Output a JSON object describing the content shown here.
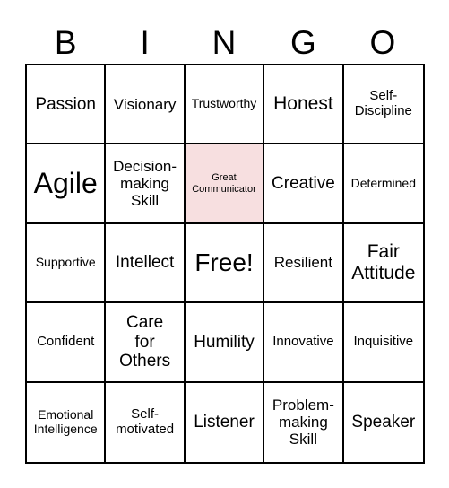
{
  "header": {
    "letters": [
      "B",
      "I",
      "N",
      "G",
      "O"
    ]
  },
  "colors": {
    "highlight": "#f7dfe0",
    "grid_line": "#000000"
  },
  "grid": {
    "rows": [
      [
        "Passion",
        "Visionary",
        "Trustworthy",
        "Honest",
        "Self-\nDiscipline"
      ],
      [
        "Agile",
        "Decision-\nmaking\nSkill",
        "Great\nCommunicator",
        "Creative",
        "Determined"
      ],
      [
        "Supportive",
        "Intellect",
        "Free!",
        "Resilient",
        "Fair\nAttitude"
      ],
      [
        "Confident",
        "Care\nfor\nOthers",
        "Humility",
        "Innovative",
        "Inquisitive"
      ],
      [
        "Emotional\nIntelligence",
        "Self-\nmotivated",
        "Listener",
        "Problem-\nmaking\nSkill",
        "Speaker"
      ]
    ],
    "highlighted_cell": "Great Communicator",
    "free_cell": "Free!"
  }
}
